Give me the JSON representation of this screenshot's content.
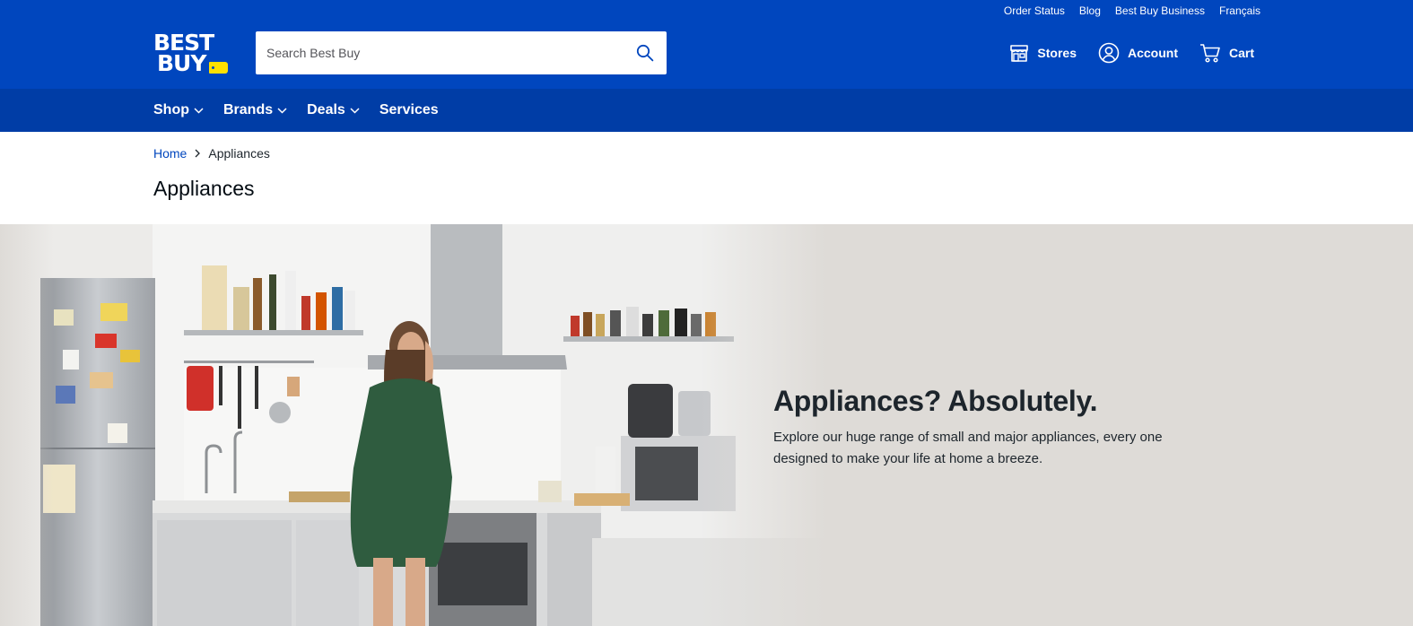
{
  "utility_links": [
    "Order Status",
    "Blog",
    "Best Buy Business",
    "Français"
  ],
  "logo": {
    "line1": "BEST",
    "line2": "BUY"
  },
  "search": {
    "placeholder": "Search Best Buy"
  },
  "header_actions": {
    "stores": "Stores",
    "account": "Account",
    "cart": "Cart"
  },
  "nav": {
    "items": [
      "Shop",
      "Brands",
      "Deals",
      "Services"
    ]
  },
  "breadcrumb": {
    "home": "Home",
    "current": "Appliances"
  },
  "page_title": "Appliances",
  "hero": {
    "headline": "Appliances? Absolutely.",
    "body": "Explore our huge range of small and major appliances, every one designed to make your life at home a breeze."
  },
  "colors": {
    "brand_blue": "#0046be",
    "nav_blue": "#003da6",
    "brand_yellow": "#ffe000",
    "hero_bg": "#dedbd7"
  },
  "icons": [
    "search-icon",
    "store-icon",
    "account-icon",
    "cart-icon",
    "chevron-down-icon",
    "chevron-right-icon"
  ]
}
